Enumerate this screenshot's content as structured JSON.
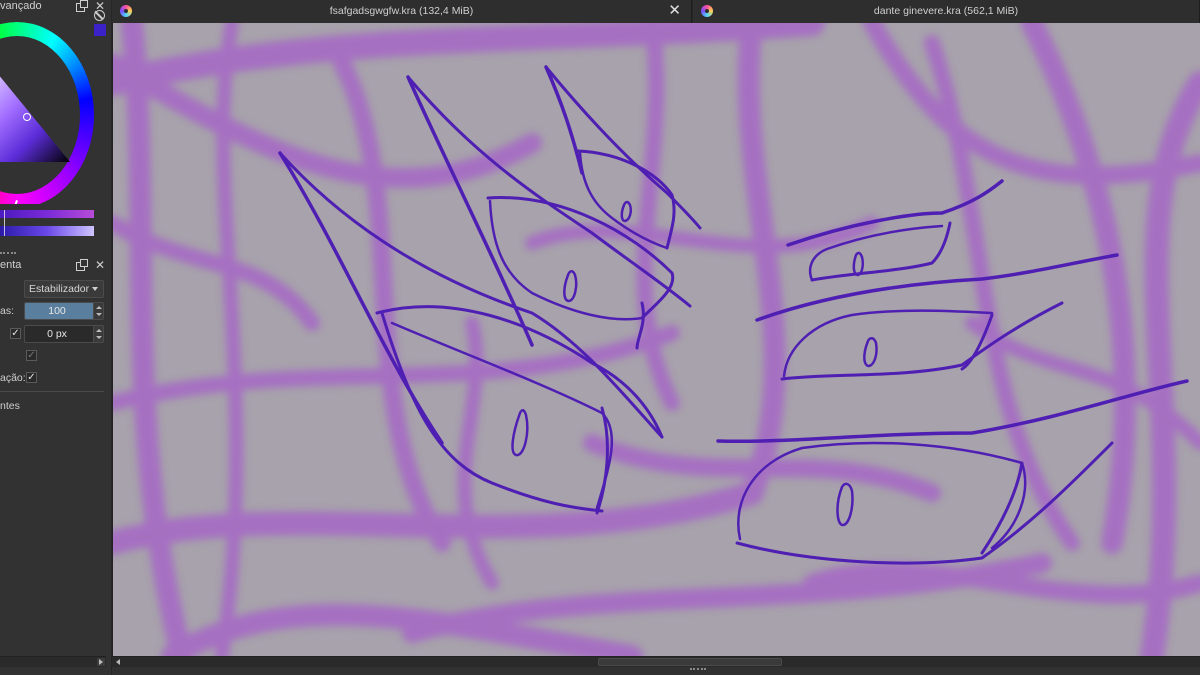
{
  "left_dock": {
    "color_panel": {
      "title": "vançado",
      "float_icon": "float-icon",
      "close_icon": "close-icon",
      "reset_icon": "no-symbol-icon",
      "close_glyph": "✕"
    },
    "tool_options": {
      "title": "enta",
      "close_glyph": "✕",
      "smoothing_combo": "Estabilizador",
      "rows": {
        "distance_label": "as:",
        "distance_value": "100",
        "distance_fraction": 1.0,
        "delay_checked": true,
        "delay_value": "0 px",
        "row3_checked": true,
        "scale_label": "ação:",
        "scale_checked": true
      },
      "footer_label": "ntes"
    }
  },
  "tabs": [
    {
      "title": "fsafgadsgwgfw.kra (132,4 MiB)",
      "active": true,
      "close_glyph": "✕"
    },
    {
      "title": "dante ginevere.kra (562,1 MiB)",
      "active": false
    }
  ],
  "canvas": {
    "background": "#a7a2ab",
    "ink_color": "#4f1fb3",
    "sketch_color": "#a667c6"
  },
  "colors": {
    "panel_bg": "#323232",
    "accent_blue": "#5a7f9e"
  }
}
